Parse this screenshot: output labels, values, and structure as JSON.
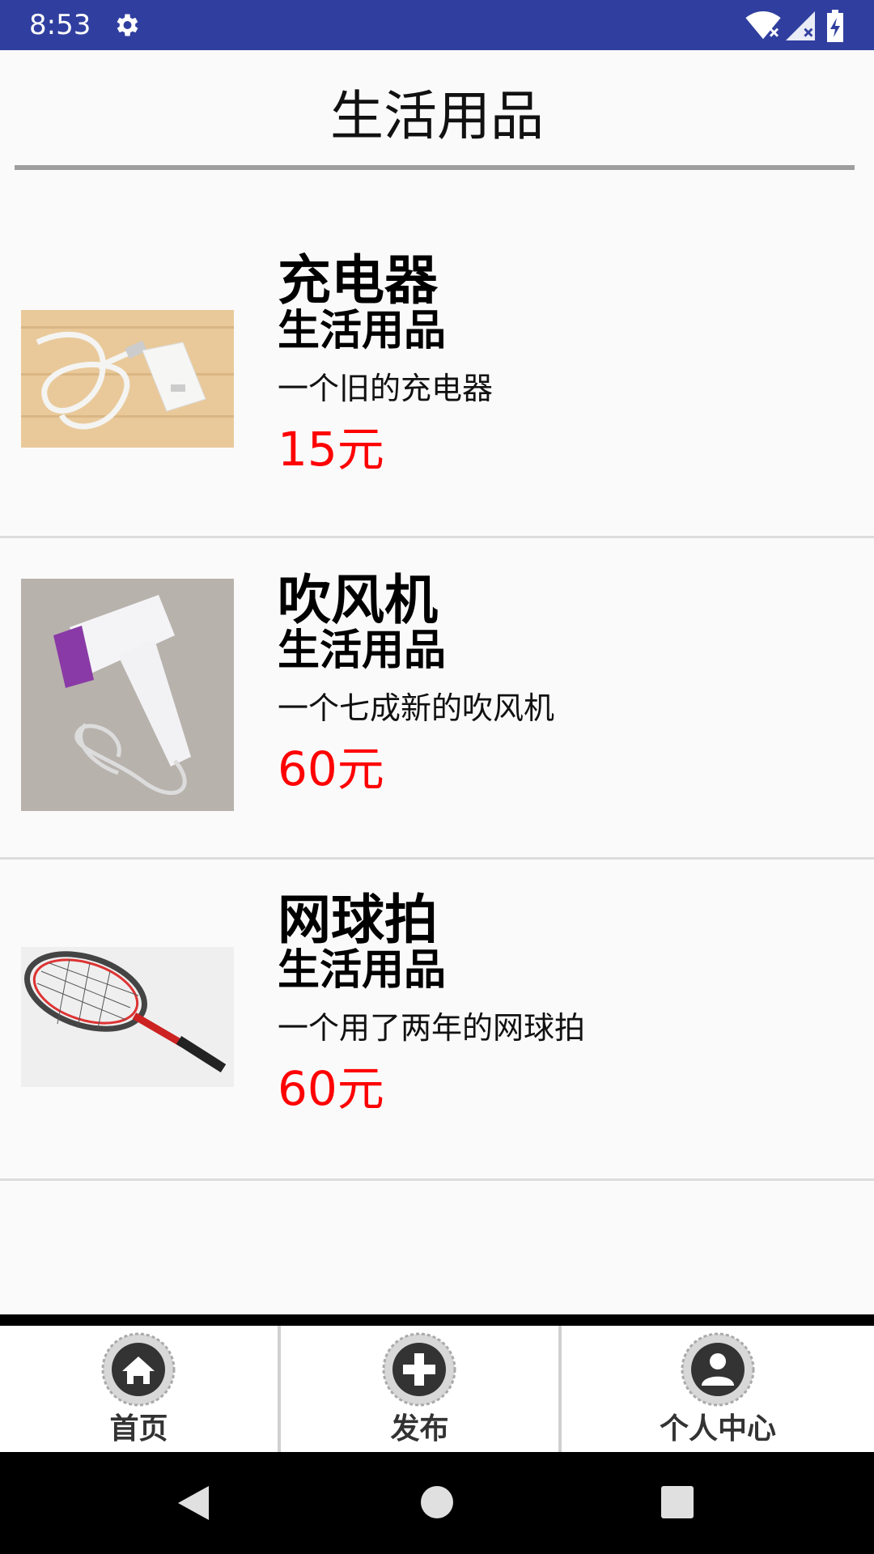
{
  "status_bar": {
    "time": "8:53"
  },
  "header": {
    "title": "生活用品"
  },
  "items": [
    {
      "title": "充电器",
      "category": "生活用品",
      "description": "一个旧的充电器",
      "price": "15元"
    },
    {
      "title": "吹风机",
      "category": "生活用品",
      "description": "一个七成新的吹风机",
      "price": "60元"
    },
    {
      "title": "网球拍",
      "category": "生活用品",
      "description": "一个用了两年的网球拍",
      "price": "60元"
    }
  ],
  "bottom_nav": [
    {
      "label": "首页",
      "icon": "home-icon"
    },
    {
      "label": "发布",
      "icon": "plus-icon"
    },
    {
      "label": "个人中心",
      "icon": "person-icon"
    }
  ],
  "system_nav": {
    "back": "back-icon",
    "home": "home-circle-icon",
    "recents": "recents-icon"
  },
  "colors": {
    "status_bar": "#303f9f",
    "price": "#ff0000",
    "divider": "#9e9e9e"
  }
}
